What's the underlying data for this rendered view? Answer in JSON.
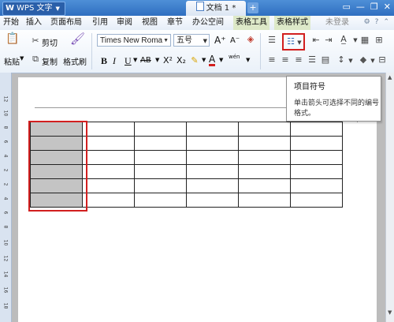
{
  "titlebar": {
    "app_name": "WPS 文字",
    "app_logo": "W",
    "document_tab": "文档 1 *",
    "new_tab": "+",
    "window_buttons": [
      "▭",
      "—",
      "❐",
      "✕"
    ]
  },
  "menu": {
    "items": [
      "开始",
      "插入",
      "页面布局",
      "引用",
      "审阅",
      "视图",
      "章节",
      "办公空间",
      "表格工具",
      "表格样式"
    ],
    "login": "未登录",
    "right_icons": [
      "skin-icon",
      "help-icon",
      "chevron-icon"
    ]
  },
  "toolbar": {
    "paste_label": "粘贴",
    "cut_label": "剪切",
    "copy_label": "复制",
    "format_painter_label": "格式刷",
    "font_name": "Times New Roma",
    "font_size": "五号",
    "bold": "B",
    "italic": "I",
    "underline": "U",
    "strikethrough": "AB",
    "superscript": "X²",
    "subscript": "X₂",
    "font_color": "A",
    "grow_font": "A⁺",
    "shrink_font": "A⁻",
    "pinyin": "wén"
  },
  "tooltip": {
    "title": "项目符号",
    "description": "单击箭头可选择不同的编号格式。"
  },
  "ruler": {
    "numbers": [
      "12",
      "10",
      "8",
      "6",
      "4",
      "2",
      "2",
      "4",
      "6",
      "8",
      "10",
      "12",
      "14",
      "16",
      "18"
    ]
  },
  "table": {
    "rows": 6,
    "columns": 6,
    "selected_column": 1
  },
  "colors": {
    "titlebar": "#3a7cc9",
    "highlight": "#d21f1f",
    "selection": "#c4c4c4",
    "contextual_tab": "#dde9c8"
  }
}
